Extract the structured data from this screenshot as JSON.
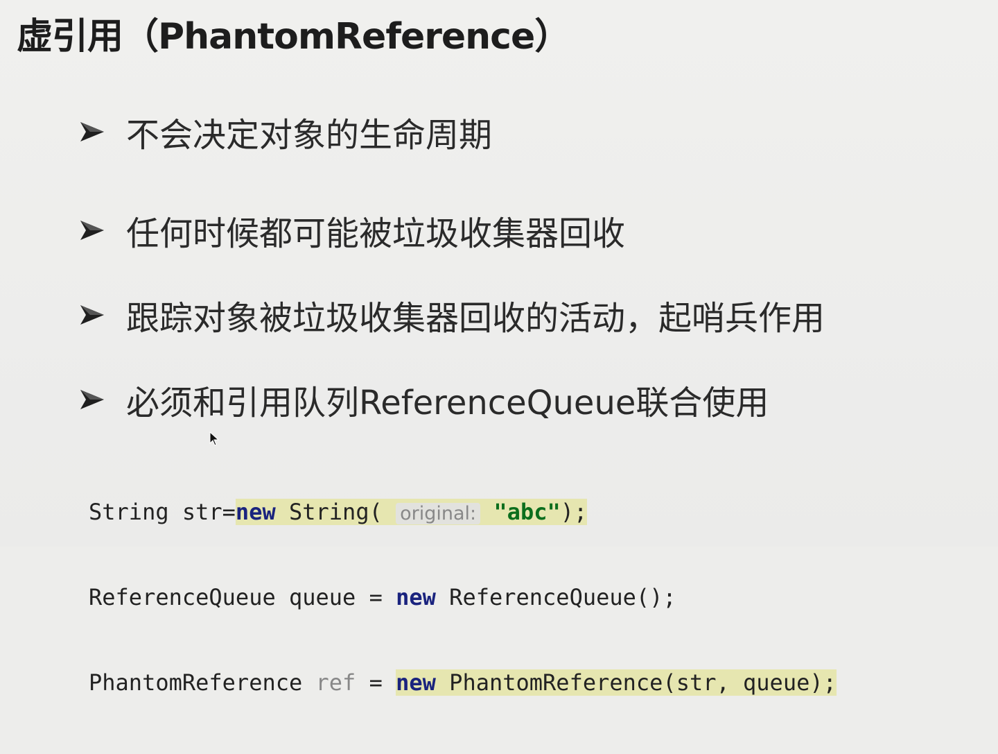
{
  "title": "虚引用（PhantomReference）",
  "bullets": [
    "不会决定对象的生命周期",
    "任何时候都可能被垃圾收集器回收",
    "跟踪对象被垃圾收集器回收的活动，起哨兵作用",
    "必须和引用队列ReferenceQueue联合使用"
  ],
  "bullet_icon": "arrowhead-bullet-icon",
  "code": {
    "line1": {
      "a": "String str=",
      "kw": "new",
      "b": " String(",
      "hint": "original:",
      "str": "\"abc\"",
      "c": ");"
    },
    "line2": {
      "a": "ReferenceQueue queue = ",
      "kw": "new",
      "b": " ReferenceQueue();"
    },
    "line3": {
      "a": "PhantomReference ",
      "var": "ref",
      "b": " = ",
      "kw": "new",
      "c": " PhantomReference(str, queue);"
    }
  },
  "colors": {
    "keyword": "#1a237e",
    "string": "#0b6e1d",
    "highlight": "#e6e6b0",
    "background": "#ededeb"
  }
}
